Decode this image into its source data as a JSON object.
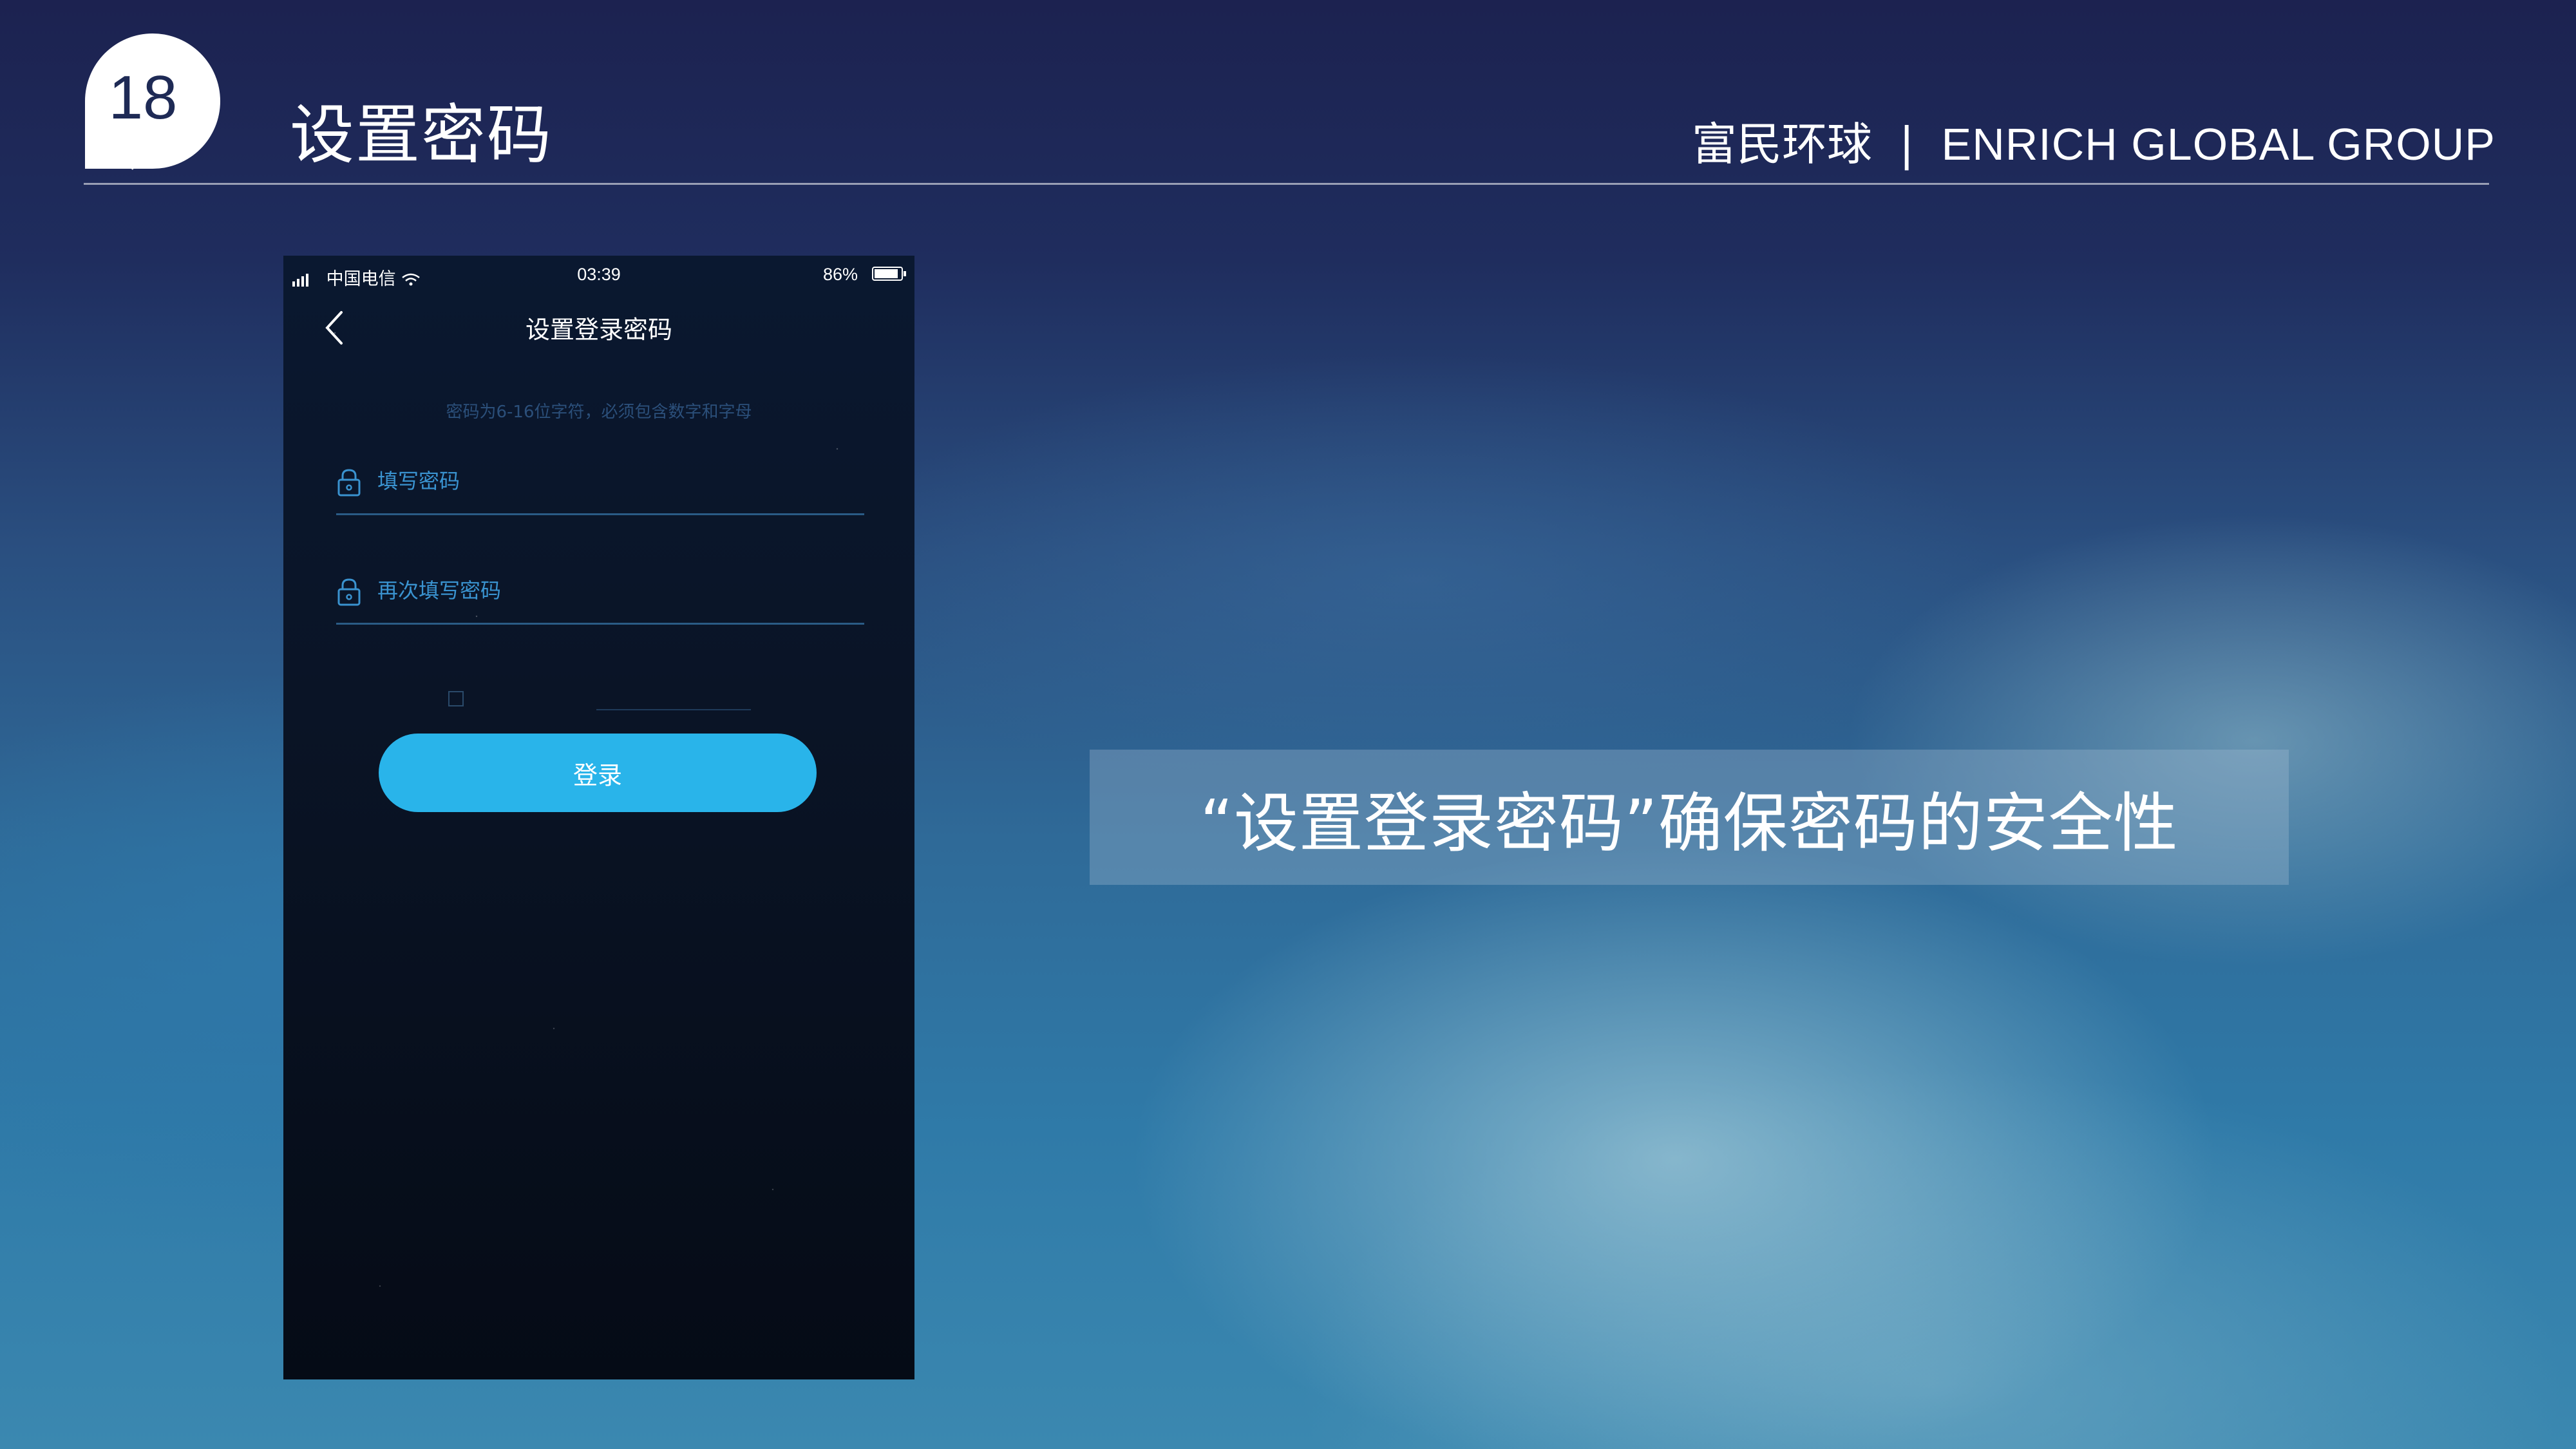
{
  "slide": {
    "number": "18",
    "title": "设置密码",
    "brand_cn": "富民环球",
    "brand_separator": "|",
    "brand_en": "ENRICH GLOBAL GROUP"
  },
  "phone": {
    "status_bar": {
      "carrier": "中国电信",
      "time": "03:39",
      "battery": "86%"
    },
    "nav": {
      "title": "设置登录密码",
      "back_icon": "chevron-left-icon"
    },
    "hint": "密码为6-16位字符，必须包含数字和字母",
    "fields": [
      {
        "placeholder": "填写密码",
        "icon": "lock-icon"
      },
      {
        "placeholder": "再次填写密码",
        "icon": "lock-icon"
      }
    ],
    "login_button": "登录",
    "colors": {
      "accent": "#29b4ea",
      "field_text": "#3a93d0"
    }
  },
  "caption": "“设置登录密码”确保密码的安全性"
}
